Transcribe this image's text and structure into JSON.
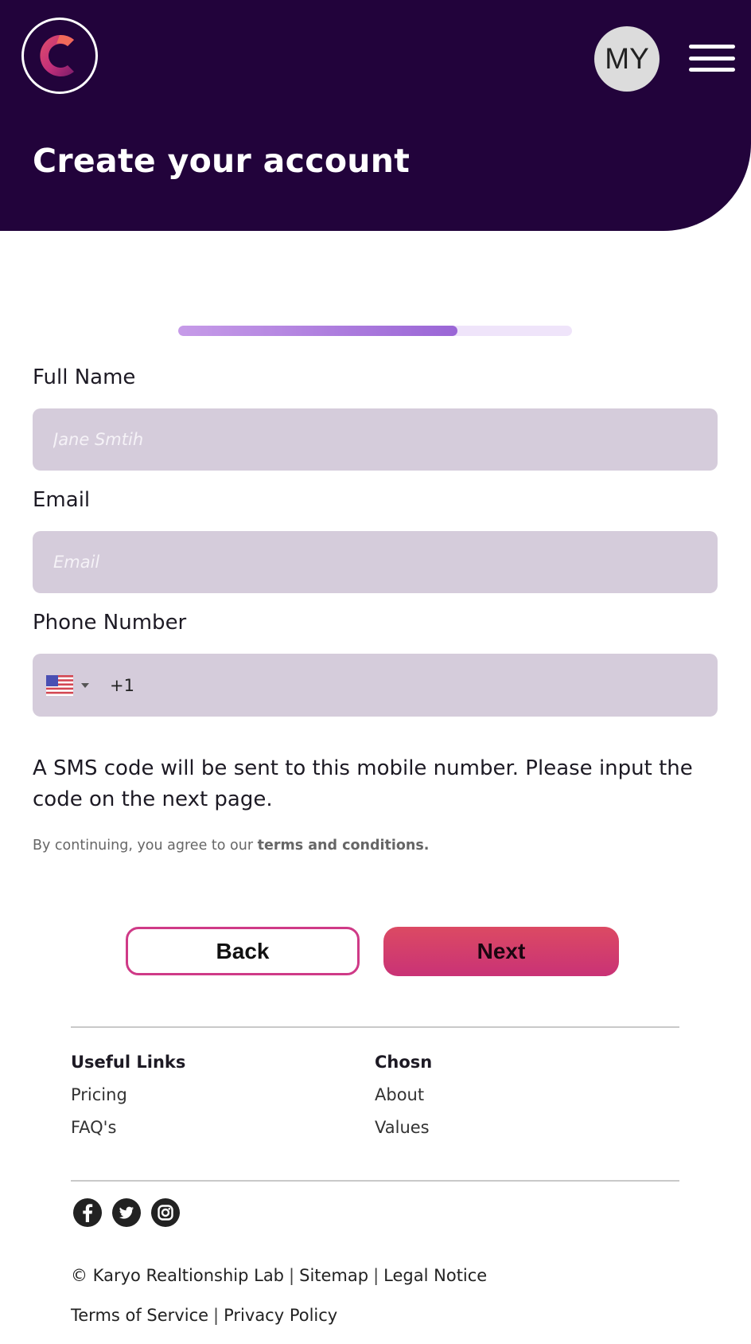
{
  "header": {
    "title": "Create your account",
    "avatar_initials": "MY"
  },
  "progress": {
    "fraction": 0.71
  },
  "form": {
    "full_name": {
      "label": "Full Name",
      "placeholder": "Jane Smtih",
      "value": ""
    },
    "email": {
      "label": "Email",
      "placeholder": "Email",
      "value": ""
    },
    "phone": {
      "label": "Phone Number",
      "country": "US",
      "dial_code": "+1",
      "value": ""
    }
  },
  "sms_note": "A SMS code will be sent to this mobile number. Please input the code on the next page.",
  "terms": {
    "prefix": "By continuing, you agree to our ",
    "link": "terms and conditions."
  },
  "buttons": {
    "back": "Back",
    "next": "Next"
  },
  "footer": {
    "columns": [
      {
        "heading": "Useful Links",
        "links": [
          "Pricing",
          "FAQ's"
        ]
      },
      {
        "heading": "Chosn",
        "links": [
          "About",
          "Values"
        ]
      }
    ],
    "socials": [
      "facebook-icon",
      "twitter-icon",
      "instagram-icon"
    ],
    "legal_line1": {
      "copyright": "© Karyo Realtionship Lab",
      "sitemap": "Sitemap",
      "legal_notice": "Legal Notice"
    },
    "legal_line2": {
      "terms_of_service": "Terms of Service",
      "privacy_policy": "Privacy Policy"
    }
  },
  "colors": {
    "header_bg": "#22033b",
    "field_bg": "#d5ccdb",
    "accent_pink": "#cf3a87",
    "progress_fill": "#9a66d6"
  }
}
